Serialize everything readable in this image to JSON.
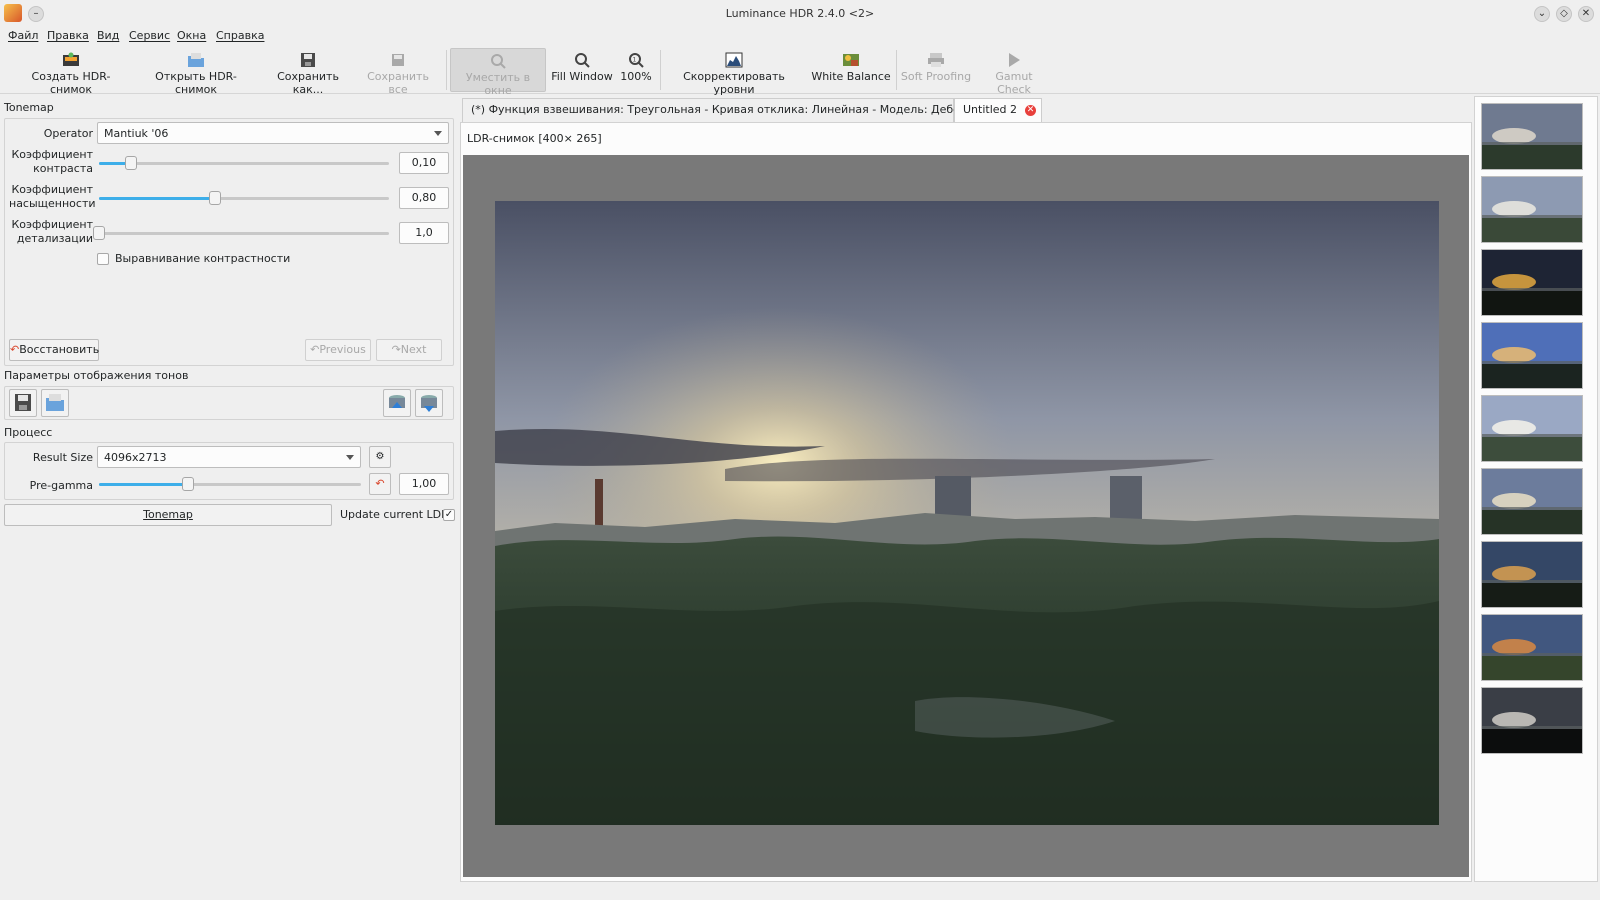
{
  "window": {
    "title": "Luminance HDR 2.4.0 <2>"
  },
  "menu": [
    "Файл",
    "Правка",
    "Вид",
    "Сервис",
    "Окна",
    "Справка"
  ],
  "toolbar": {
    "create_hdr": "Создать HDR-снимок",
    "open_hdr": "Открыть HDR-снимок",
    "save_as": "Сохранить как...",
    "save_all": "Сохранить все",
    "fit_window": "Уместить в окне",
    "fill_window": "Fill Window",
    "zoom_100": "100%",
    "adjust_levels": "Скорректировать уровни",
    "white_balance": "White Balance",
    "soft_proofing": "Soft Proofing",
    "gamut_check": "Gamut Check"
  },
  "tonemap": {
    "section_title": "Tonemap",
    "operator_label": "Operator",
    "operator_value": "Mantiuk '06",
    "params": [
      {
        "label_line1": "Коэффициент",
        "label_line2": "контраста",
        "value": "0,10",
        "level": 0.11
      },
      {
        "label_line1": "Коэффициент",
        "label_line2": "насыщенности",
        "value": "0,80",
        "level": 0.4
      },
      {
        "label_line1": "Коэффициент",
        "label_line2": "детализации",
        "value": "1,0",
        "level": 0.0
      }
    ],
    "contrast_eq_label": "Выравнивание контрастности",
    "contrast_eq_checked": false,
    "reset_button": "Восстановить",
    "previous_button": "Previous",
    "next_button": "Next"
  },
  "tone_params": {
    "section_title": "Параметры отображения тонов"
  },
  "process": {
    "section_title": "Процесс",
    "result_size_label": "Result Size",
    "result_size_value": "4096x2713",
    "pregamma_label": "Pre-gamma",
    "pregamma_value": "1,00",
    "pregamma_level": 0.34,
    "tonemap_button": "Tonemap",
    "update_ldr_label": "Update current LDR",
    "update_ldr_checked": "✓"
  },
  "tabs": [
    {
      "label": "(*) Функция взвешивания: Треугольная - Кривая отклика: Линейная - Модель: Дебевек",
      "active": false
    },
    {
      "label": "Untitled 2",
      "active": true
    }
  ],
  "viewer": {
    "caption": "LDR-снимок [400× 265]"
  },
  "thumbnails": [
    {
      "sky": "#6f7a90",
      "sun": "#e6dfcf",
      "ground": "#2c3a2c"
    },
    {
      "sky": "#8d9ab2",
      "sun": "#f3efe3",
      "ground": "#3a4938"
    },
    {
      "sky": "#1e2434",
      "sun": "#f0b040",
      "ground": "#111511"
    },
    {
      "sky": "#4f6fb8",
      "sun": "#f7c26a",
      "ground": "#1b2420"
    },
    {
      "sky": "#9aa8c4",
      "sun": "#fbf7ee",
      "ground": "#3d4d3c"
    },
    {
      "sky": "#6c7c9c",
      "sun": "#f2e6c8",
      "ground": "#263326"
    },
    {
      "sky": "#344766",
      "sun": "#e7a64e",
      "ground": "#161c16"
    },
    {
      "sky": "#41577f",
      "sun": "#e28c3f",
      "ground": "#35452c"
    },
    {
      "sky": "#3a3e46",
      "sun": "#d9d6ce",
      "ground": "#0c0d0d"
    }
  ]
}
